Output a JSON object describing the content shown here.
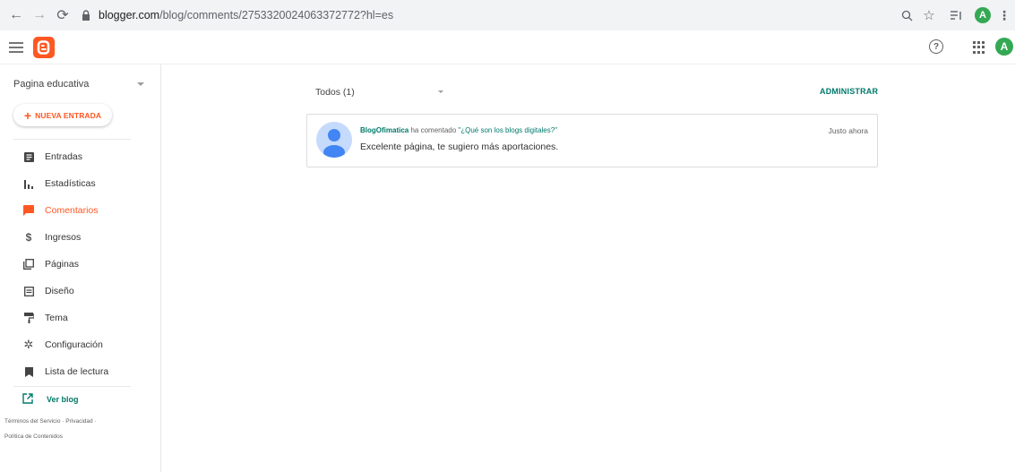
{
  "browser": {
    "url_host": "blogger.com",
    "url_path": "/blog/comments/2753320024063372772?hl=es",
    "avatar_letter": "A"
  },
  "header": {
    "avatar_letter": "A",
    "help_glyph": "?"
  },
  "sidebar": {
    "blog_name": "Pagina educativa",
    "new_post_label": "NUEVA ENTRADA",
    "items": [
      {
        "label": "Entradas",
        "icon": "document-icon"
      },
      {
        "label": "Estadísticas",
        "icon": "bar-chart-icon"
      },
      {
        "label": "Comentarios",
        "icon": "comment-icon",
        "active": true
      },
      {
        "label": "Ingresos",
        "icon": "dollar-icon"
      },
      {
        "label": "Páginas",
        "icon": "pages-icon"
      },
      {
        "label": "Diseño",
        "icon": "layout-icon"
      },
      {
        "label": "Tema",
        "icon": "paint-roller-icon"
      },
      {
        "label": "Configuración",
        "icon": "gear-icon"
      },
      {
        "label": "Lista de lectura",
        "icon": "bookmark-icon"
      }
    ],
    "view_blog_label": "Ver blog",
    "footer": {
      "terms": "Términos del Servicio",
      "privacy": "Privacidad",
      "content_policy": "Política de Contenidos"
    }
  },
  "main": {
    "filter_label": "Todos (1)",
    "manage_label": "ADMINISTRAR",
    "comments": [
      {
        "author": "BlogOfimatica",
        "action": "ha comentado",
        "post_title": "\"¿Qué son los blogs digitales?\"",
        "text": "Excelente página, te sugiero más aportaciones.",
        "time": "Justo ahora"
      }
    ]
  },
  "colors": {
    "accent": "#ff5722",
    "link": "#00796b",
    "avatar_green": "#34a853"
  }
}
